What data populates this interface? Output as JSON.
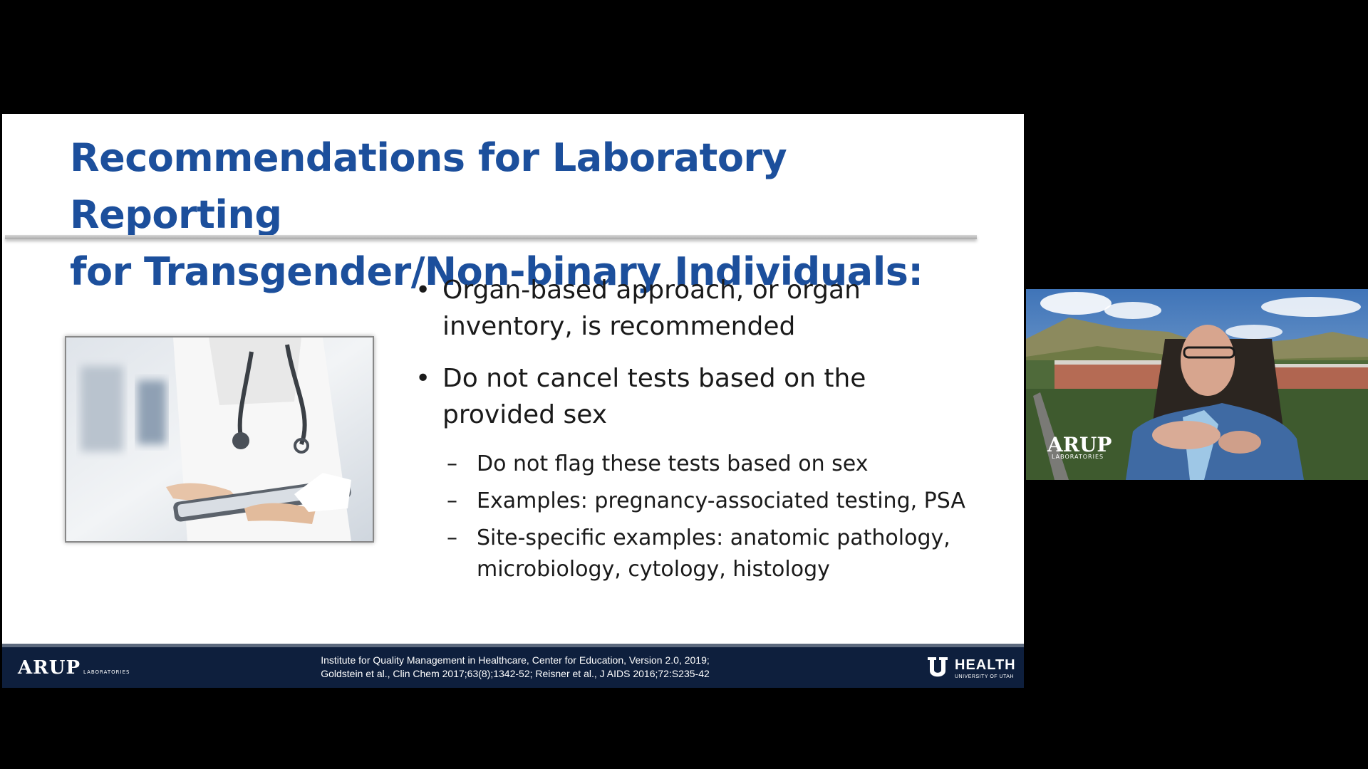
{
  "slide": {
    "title_line1": "Recommendations for Laboratory Reporting",
    "title_line2": "for Transgender/Non-binary Individuals:",
    "bullets": [
      {
        "marker": "•",
        "text_line1": "Organ-based approach, or organ",
        "text_line2": "inventory, is recommended"
      },
      {
        "marker": "•",
        "text_line1": "Do not cancel tests based on the",
        "text_line2": "provided sex"
      }
    ],
    "sub_bullets": [
      {
        "marker": "–",
        "text_line1": "Do not flag these tests based on sex",
        "text_line2": ""
      },
      {
        "marker": "–",
        "text_line1": "Examples: pregnancy-associated testing, PSA",
        "text_line2": ""
      },
      {
        "marker": "–",
        "text_line1": "Site-specific examples: anatomic pathology,",
        "text_line2": "microbiology, cytology, histology"
      }
    ],
    "photo_icon": "doctor-with-tablet-image"
  },
  "footer": {
    "left_logo": "ARUP",
    "left_logo_sub": "LABORATORIES",
    "citation_line1": "Institute for Quality Management in Healthcare, Center for Education, Version 2.0, 2019;",
    "citation_line2": "Goldstein et al., Clin Chem 2017;63(8);1342-52;  Reisner et al., J AIDS 2016;72:S235-42",
    "right_logo": "HEALTH",
    "right_logo_sub": "UNIVERSITY OF UTAH"
  },
  "webcam": {
    "logo": "ARUP",
    "logo_sub": "LABORATORIES",
    "icon": "presenter-video-feed"
  },
  "colors": {
    "title": "#1c4f9c",
    "footer_bg": "#0e1f3d",
    "background": "#000000"
  }
}
